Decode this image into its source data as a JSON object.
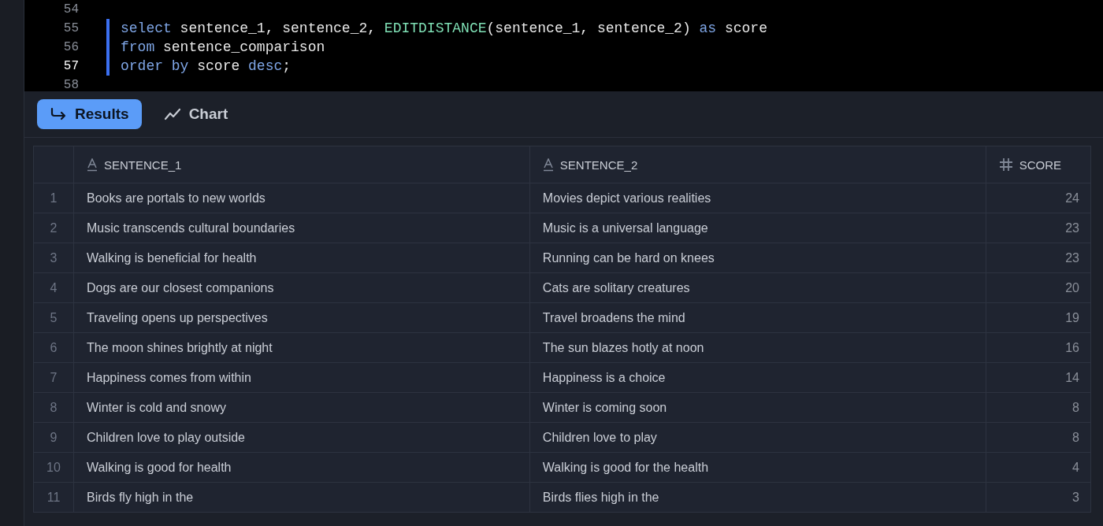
{
  "editor": {
    "lines": [
      {
        "number": "54",
        "current": false,
        "changed": false
      },
      {
        "number": "55",
        "current": false,
        "changed": true,
        "tokens": [
          {
            "kind": "keyword",
            "text": "select"
          },
          {
            "kind": "plain",
            "text": " sentence_1, sentence_2, "
          },
          {
            "kind": "function",
            "text": "EDITDISTANCE"
          },
          {
            "kind": "plain",
            "text": "(sentence_1, sentence_2) "
          },
          {
            "kind": "keyword",
            "text": "as"
          },
          {
            "kind": "plain",
            "text": " score"
          }
        ]
      },
      {
        "number": "56",
        "current": false,
        "changed": true,
        "tokens": [
          {
            "kind": "keyword",
            "text": "from"
          },
          {
            "kind": "plain",
            "text": " sentence_comparison"
          }
        ]
      },
      {
        "number": "57",
        "current": true,
        "changed": true,
        "tokens": [
          {
            "kind": "keyword",
            "text": "order by"
          },
          {
            "kind": "plain",
            "text": " score "
          },
          {
            "kind": "keyword",
            "text": "desc"
          },
          {
            "kind": "plain",
            "text": ";"
          }
        ]
      },
      {
        "number": "58",
        "current": false,
        "changed": false
      }
    ]
  },
  "tabs": [
    {
      "label": "Results",
      "kind": "results",
      "selected": true
    },
    {
      "label": "Chart",
      "kind": "chart",
      "selected": false
    }
  ],
  "table": {
    "columns": [
      {
        "label": "SENTENCE_1",
        "kind": "text"
      },
      {
        "label": "SENTENCE_2",
        "kind": "text"
      },
      {
        "label": "SCORE",
        "kind": "number"
      }
    ],
    "rows": [
      {
        "index": "1",
        "cells": [
          "Books are portals to new worlds",
          "Movies depict various realities",
          "24"
        ]
      },
      {
        "index": "2",
        "cells": [
          "Music transcends cultural boundaries",
          "Music is a universal language",
          "23"
        ]
      },
      {
        "index": "3",
        "cells": [
          "Walking is beneficial for health",
          "Running can be hard on knees",
          "23"
        ]
      },
      {
        "index": "4",
        "cells": [
          "Dogs are our closest companions",
          "Cats are solitary creatures",
          "20"
        ]
      },
      {
        "index": "5",
        "cells": [
          "Traveling opens up perspectives",
          "Travel broadens the mind",
          "19"
        ]
      },
      {
        "index": "6",
        "cells": [
          "The moon shines brightly at night",
          "The sun blazes hotly at noon",
          "16"
        ]
      },
      {
        "index": "7",
        "cells": [
          "Happiness comes from within",
          "Happiness is a choice",
          "14"
        ]
      },
      {
        "index": "8",
        "cells": [
          "Winter is cold and snowy",
          "Winter is coming soon",
          "8"
        ]
      },
      {
        "index": "9",
        "cells": [
          "Children love to play outside",
          "Children love to play",
          "8"
        ]
      },
      {
        "index": "10",
        "cells": [
          "Walking is good for health",
          "Walking is good for the health",
          "4"
        ]
      },
      {
        "index": "11",
        "cells": [
          "Birds fly high in the",
          "Birds flies high in the",
          "3"
        ]
      }
    ]
  }
}
